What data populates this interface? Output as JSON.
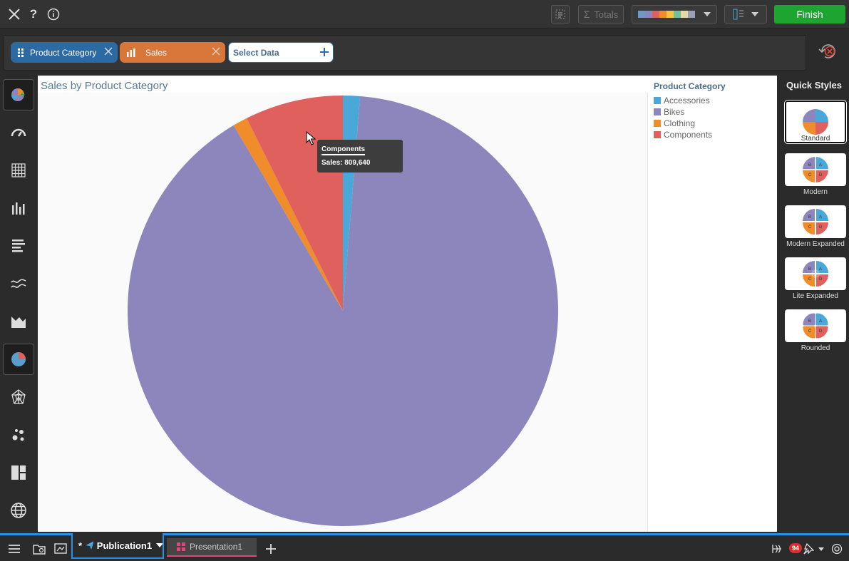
{
  "toolbar": {
    "totals_label": "Totals",
    "finish_label": "Finish"
  },
  "databar": {
    "pills": [
      {
        "label": "Product Category",
        "color": "#2c6aa4"
      },
      {
        "label": "Sales",
        "color": "#d9773b"
      }
    ],
    "select_data_label": "Select Data"
  },
  "chart_data": {
    "type": "pie",
    "title": "Sales by Product Category",
    "legend_title": "Product Category",
    "legend_position": "top-right",
    "categories": [
      "Accessories",
      "Bikes",
      "Clothing",
      "Components"
    ],
    "values": [
      140000,
      9900000,
      120000,
      809640
    ],
    "colors": [
      "#4aa8d8",
      "#8c86bc",
      "#f08c2a",
      "#e0605e"
    ],
    "tooltip": {
      "title": "Components",
      "line": "Sales: 809,640"
    }
  },
  "quick_styles": {
    "title": "Quick Styles",
    "items": [
      "Standard",
      "Modern",
      "Modern Expanded",
      "Lite Expanded",
      "Rounded"
    ]
  },
  "tabs": {
    "publication_label": "Publication1",
    "publication_marker": "*",
    "presentation_label": "Presentation1",
    "notification_count": "94"
  }
}
